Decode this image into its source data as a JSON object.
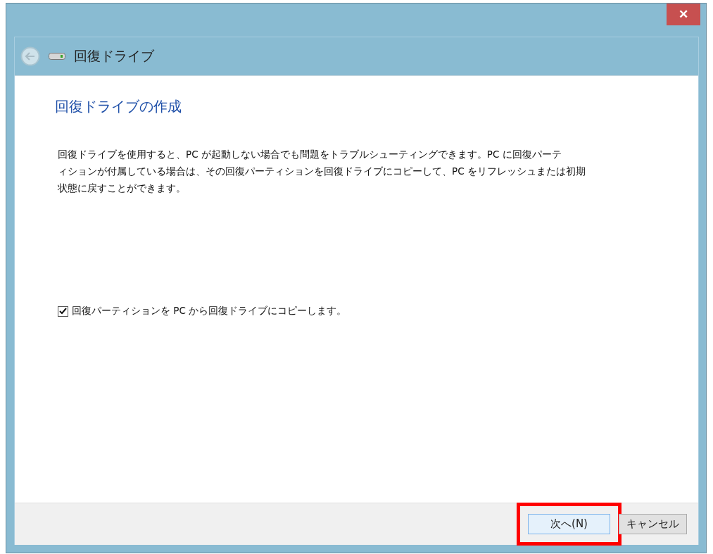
{
  "window": {
    "close_label": "✕"
  },
  "nav": {
    "title": "回復ドライブ"
  },
  "heading": "回復ドライブの作成",
  "description_lines": [
    "回復ドライブを使用すると、PC が起動しない場合でも問題をトラブルシューティングできます。PC に回復パーテ",
    "ィションが付属している場合は、その回復パーティションを回復ドライブにコピーして、PC をリフレッシュまたは初期",
    "状態に戻すことができます。"
  ],
  "option": {
    "label": "回復パーティションを PC から回復ドライブにコピーします。",
    "checked": true
  },
  "buttons": [
    {
      "label": "次へ(N)",
      "kind": "primary",
      "highlighted": true
    },
    {
      "label": "キャンセル",
      "kind": "normal",
      "highlighted": false
    }
  ]
}
